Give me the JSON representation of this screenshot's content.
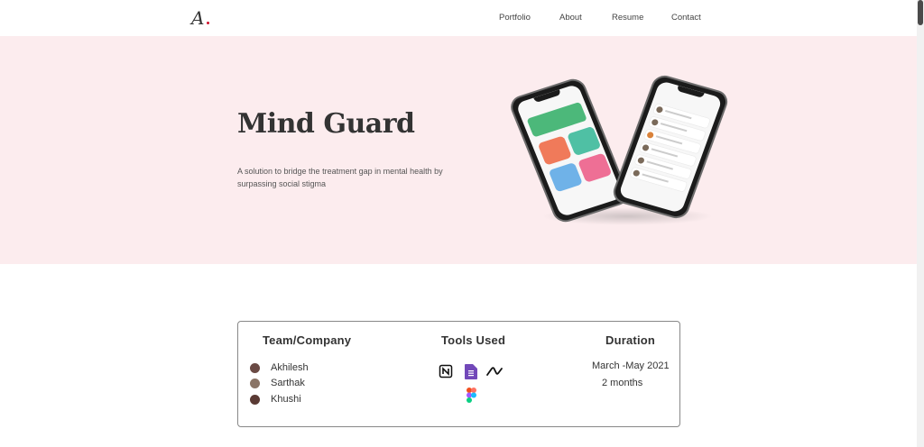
{
  "nav": {
    "logo": "A",
    "links": [
      "Portfolio",
      "About",
      "Resume",
      "Contact"
    ]
  },
  "hero": {
    "title": "Mind Guard",
    "description": "A solution to bridge the treatment gap in mental health by surpassing social stigma"
  },
  "info": {
    "team_heading": "Team/Company",
    "tools_heading": "Tools Used",
    "duration_heading": "Duration",
    "members": [
      "Akhilesh",
      "Sarthak",
      "Khushi"
    ],
    "tools": [
      "notion-icon",
      "google-forms-icon",
      "maze-icon",
      "figma-icon"
    ],
    "duration_range": "March -May 2021",
    "duration_length": "2 months"
  },
  "colors": {
    "hero_bg": "#fcecee",
    "logo_dot": "#d0112b",
    "card_border": "#888888"
  }
}
